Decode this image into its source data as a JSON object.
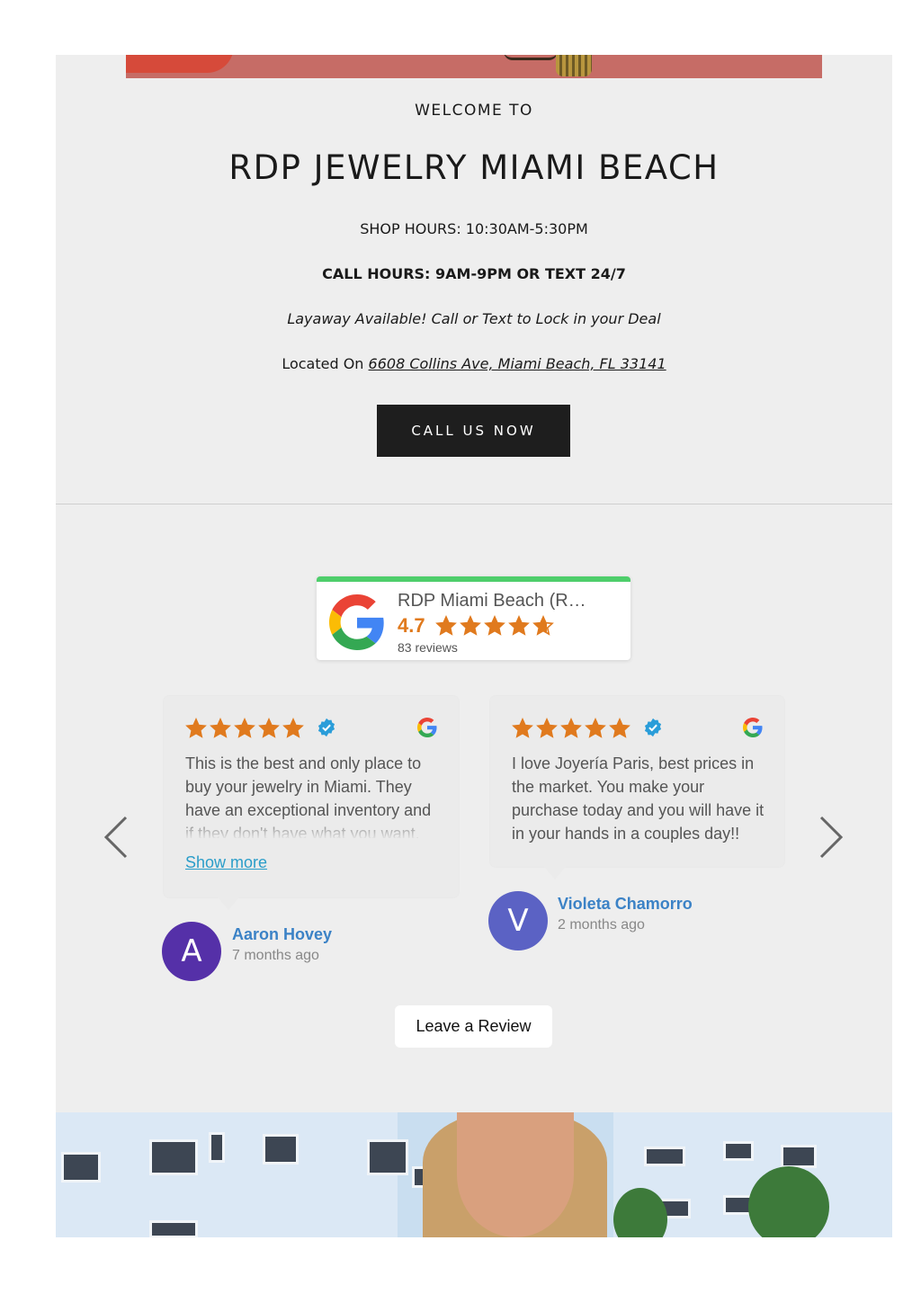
{
  "header": {
    "welcome": "WELCOME TO",
    "title": "RDP JEWELRY MIAMI BEACH",
    "shop_hours": "SHOP HOURS: 10:30AM-5:30PM",
    "call_hours": "CALL HOURS: 9AM-9PM OR TEXT 24/7",
    "layaway": "Layaway Available! Call or Text to Lock in your Deal",
    "located_prefix": "Located On",
    "address": "6608 Collins Ave, Miami Beach, FL 33141",
    "cta_label": "CALL US NOW"
  },
  "reviews_summary": {
    "business_name": "RDP Miami Beach (R…",
    "rating": "4.7",
    "rating_value": 4.7,
    "max_stars": 5,
    "review_count": "83 reviews",
    "accent_color": "#4ece6b",
    "star_color": "#e07a1e"
  },
  "reviews": [
    {
      "stars": 5,
      "text": "This is the best and only place to buy your jewelry in Miami. They have an exceptional inventory and if they don't have what you want,",
      "show_more": "Show more",
      "author": "Aaron Hovey",
      "initial": "A",
      "time": "7 months ago",
      "avatar_color": "#5530a8"
    },
    {
      "stars": 5,
      "text": "I love Joyería Paris, best prices in the market. You make your purchase today and you will have it in your hands in a couples day!!",
      "author": "Violeta Chamorro",
      "initial": "V",
      "time": "2 months ago",
      "avatar_color": "#5b62c4"
    }
  ],
  "carousel": {
    "prev_icon": "chevron-left-icon",
    "next_icon": "chevron-right-icon"
  },
  "leave_review_label": "Leave a Review",
  "colors": {
    "page_bg": "#eeeeee",
    "cta_bg": "#1e1e1e",
    "link": "#2a9dc9",
    "author": "#3b82c6"
  }
}
